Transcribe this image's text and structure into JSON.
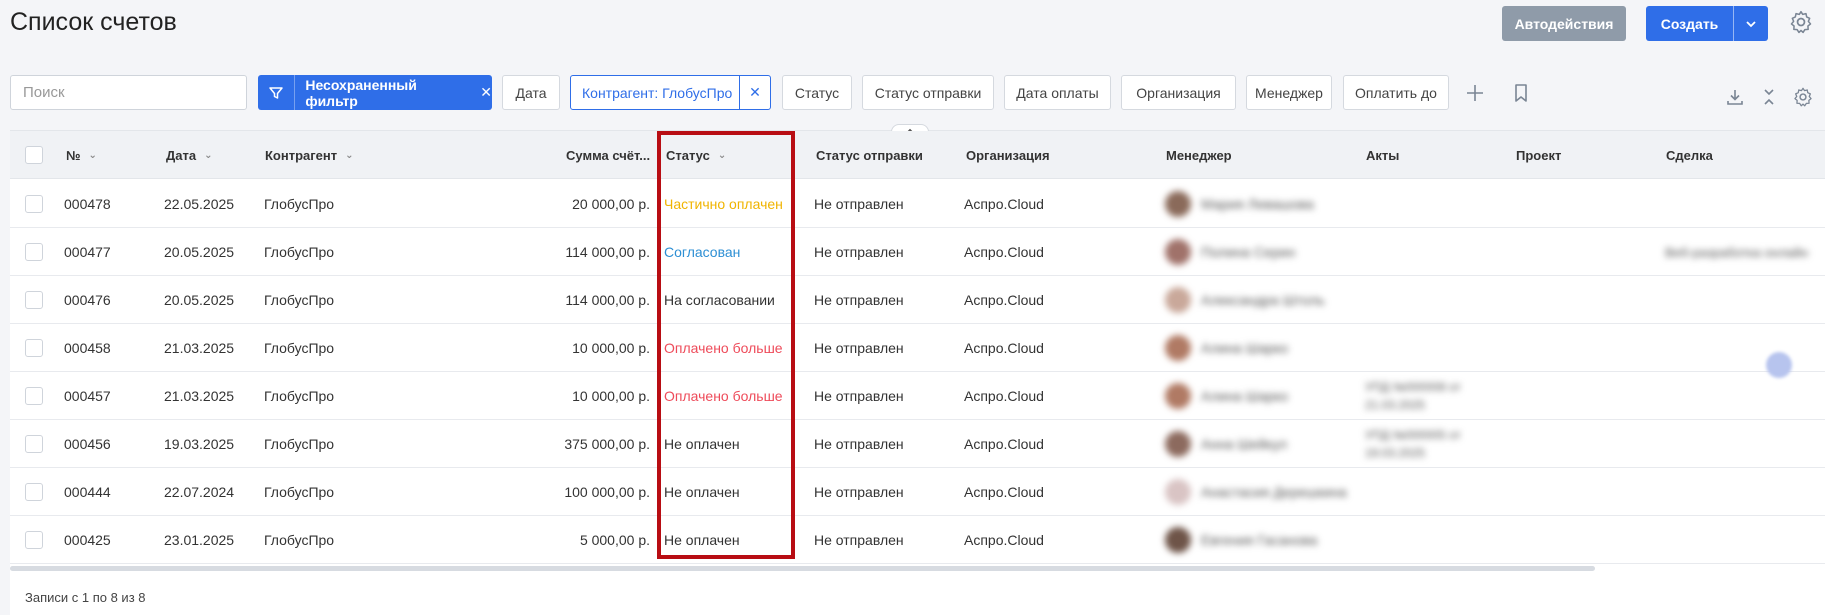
{
  "header": {
    "title": "Список счетов",
    "auto_label": "Автодействия",
    "create_label": "Создать"
  },
  "filters": {
    "search_placeholder": "Поиск",
    "unsaved_filter_label": "Несохраненный фильтр",
    "date": "Дата",
    "counterparty_chip": "Контрагент: ГлобусПро",
    "status": "Статус",
    "send_status": "Статус отправки",
    "payment_date": "Дата оплаты",
    "organization": "Организация",
    "manager": "Менеджер",
    "pay_until": "Оплатить до"
  },
  "table": {
    "columns": {
      "number": "№",
      "date": "Дата",
      "counterparty": "Контрагент",
      "amount": "Сумма счёт...",
      "status": "Статус",
      "send_status": "Статус отправки",
      "organization": "Организация",
      "manager": "Менеджер",
      "acts": "Акты",
      "project": "Проект",
      "deal": "Сделка"
    },
    "rows": [
      {
        "number": "000478",
        "date": "22.05.2025",
        "counterparty": "ГлобусПро",
        "amount": "20 000,00 р.",
        "status": "Частично оплачен",
        "status_color": "#f0b400",
        "send_status": "Не отправлен",
        "organization": "Аспро.Cloud",
        "manager": "Мария Левашова",
        "avatar_color": "#8a6a5a",
        "acts": "",
        "deal": ""
      },
      {
        "number": "000477",
        "date": "20.05.2025",
        "counterparty": "ГлобусПро",
        "amount": "114 000,00 р.",
        "status": "Согласован",
        "status_color": "#2d8fd4",
        "send_status": "Не отправлен",
        "organization": "Аспро.Cloud",
        "manager": "Полина Серин",
        "avatar_color": "#a0726a",
        "acts": "",
        "deal": "Веб-разработка онлайн"
      },
      {
        "number": "000476",
        "date": "20.05.2025",
        "counterparty": "ГлобусПро",
        "amount": "114 000,00 р.",
        "status": "На согласовании",
        "status_color": "#333333",
        "send_status": "Не отправлен",
        "organization": "Аспро.Cloud",
        "manager": "Александра Штоль",
        "avatar_color": "#c9a89a",
        "acts": "",
        "deal": ""
      },
      {
        "number": "000458",
        "date": "21.03.2025",
        "counterparty": "ГлобусПро",
        "amount": "10 000,00 р.",
        "status": "Оплачено больше",
        "status_color": "#ee4b5a",
        "send_status": "Не отправлен",
        "organization": "Аспро.Cloud",
        "manager": "Алина Шарко",
        "avatar_color": "#b07a64",
        "acts": "",
        "deal": ""
      },
      {
        "number": "000457",
        "date": "21.03.2025",
        "counterparty": "ГлобусПро",
        "amount": "10 000,00 р.",
        "status": "Оплачено больше",
        "status_color": "#ee4b5a",
        "send_status": "Не отправлен",
        "organization": "Аспро.Cloud",
        "manager": "Алина Шарко",
        "avatar_color": "#b07a64",
        "acts": "УПД №000008 от 21.03.2025",
        "deal": ""
      },
      {
        "number": "000456",
        "date": "19.03.2025",
        "counterparty": "ГлобусПро",
        "amount": "375 000,00 р.",
        "status": "Не оплачен",
        "status_color": "#333333",
        "send_status": "Не отправлен",
        "organization": "Аспро.Cloud",
        "manager": "Анна Шейкул",
        "avatar_color": "#8c6a5e",
        "acts": "УПД №000005 от 19.03.2025",
        "deal": ""
      },
      {
        "number": "000444",
        "date": "22.07.2024",
        "counterparty": "ГлобусПро",
        "amount": "100 000,00 р.",
        "status": "Не оплачен",
        "status_color": "#333333",
        "send_status": "Не отправлен",
        "organization": "Аспро.Cloud",
        "manager": "Анастасия Дерешкина",
        "avatar_color": "#d9c4c4",
        "acts": "",
        "deal": ""
      },
      {
        "number": "000425",
        "date": "23.01.2025",
        "counterparty": "ГлобусПро",
        "amount": "5 000,00 р.",
        "status": "Не оплачен",
        "status_color": "#333333",
        "send_status": "Не отправлен",
        "organization": "Аспро.Cloud",
        "manager": "Евгения Гасанова",
        "avatar_color": "#6e5448",
        "acts": "",
        "deal": ""
      }
    ]
  },
  "footer": {
    "records": "Записи с 1 по 8 из 8"
  }
}
